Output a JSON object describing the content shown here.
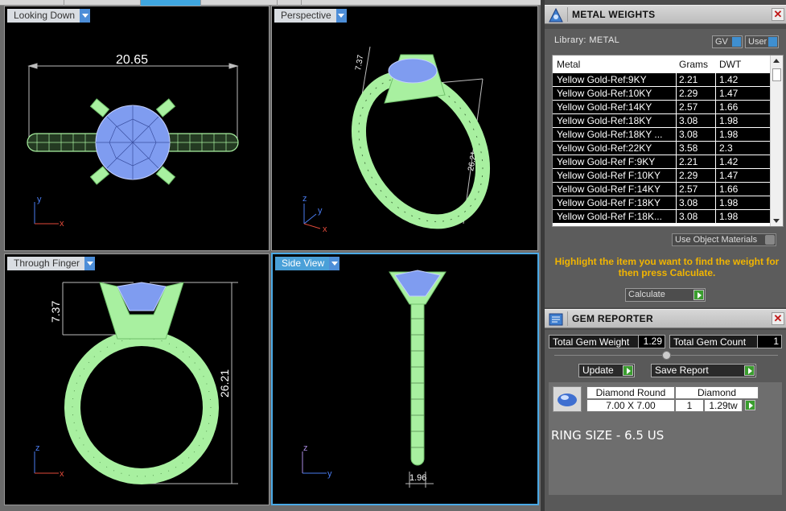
{
  "viewports": {
    "looking_down": {
      "label": "Looking Down",
      "dim": "20.65"
    },
    "perspective": {
      "label": "Perspective",
      "dim_top": "7.37",
      "dim_height": "26.21"
    },
    "through_finger": {
      "label": "Through Finger",
      "dim_top": "7.37",
      "dim_height": "26.21"
    },
    "side_view": {
      "label": "Side View",
      "dim_width": "1.96"
    },
    "axis": {
      "x": "x",
      "y": "y",
      "z": "z"
    }
  },
  "metal_weights": {
    "title": "METAL WEIGHTS",
    "library_label": "Library: METAL",
    "gv_button": "GV",
    "user_button": "User",
    "columns": [
      "Metal",
      "Grams",
      "DWT"
    ],
    "rows": [
      [
        "Yellow Gold-Ref:9KY",
        "2.21",
        "1.42"
      ],
      [
        "Yellow Gold-Ref:10KY",
        "2.29",
        "1.47"
      ],
      [
        "Yellow Gold-Ref:14KY",
        "2.57",
        "1.66"
      ],
      [
        "Yellow Gold-Ref:18KY",
        "3.08",
        "1.98"
      ],
      [
        "Yellow Gold-Ref:18KY ...",
        "3.08",
        "1.98"
      ],
      [
        "Yellow Gold-Ref:22KY",
        "3.58",
        "2.3"
      ],
      [
        "Yellow Gold-Ref F:9KY",
        "2.21",
        "1.42"
      ],
      [
        "Yellow Gold-Ref F:10KY",
        "2.29",
        "1.47"
      ],
      [
        "Yellow Gold-Ref F:14KY",
        "2.57",
        "1.66"
      ],
      [
        "Yellow Gold-Ref F:18KY",
        "3.08",
        "1.98"
      ],
      [
        "Yellow Gold-Ref F:18K...",
        "3.08",
        "1.98"
      ]
    ],
    "use_object_materials": "Use Object Materials",
    "hint": "Highlight the item you want to find the weight for then press Calculate.",
    "calculate": "Calculate"
  },
  "gem_reporter": {
    "title": "GEM REPORTER",
    "total_weight_label": "Total Gem Weight",
    "total_weight_value": "1.29",
    "total_count_label": "Total Gem Count",
    "total_count_value": "1",
    "update": "Update",
    "save_report": "Save Report",
    "gem": {
      "name": "Diamond Round",
      "size": "7.00 X 7.00",
      "material": "Diamond",
      "count": "1",
      "weight": "1.29tw"
    },
    "ring_size": "RING SIZE - 6.5 US"
  },
  "colors": {
    "ring": "#a8f0a0",
    "stone": "#7f9cf0",
    "accent": "#4aa9e6",
    "hint": "#f2b500"
  }
}
